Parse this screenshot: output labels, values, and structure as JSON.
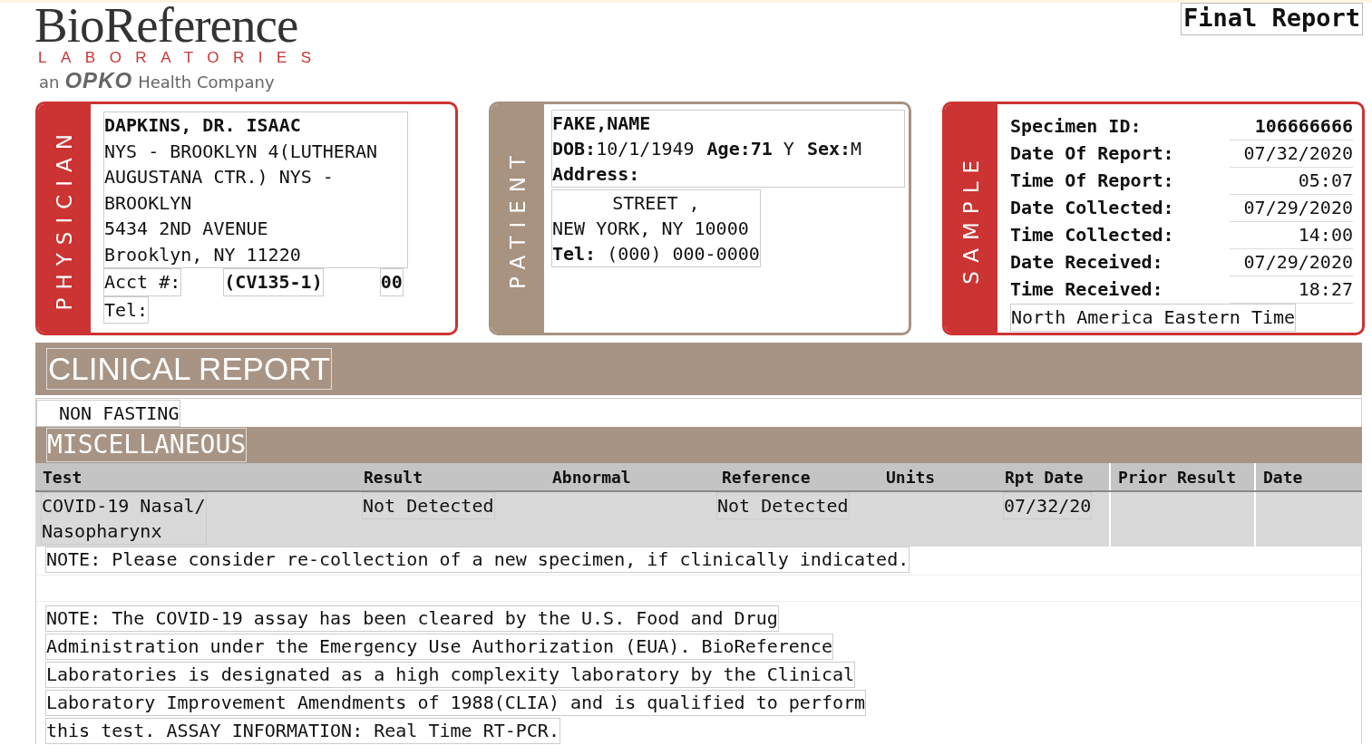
{
  "logo": {
    "name": "BioReference",
    "subtitle": "LABORATORIES",
    "prefix": "an",
    "brand": "OPKO",
    "suffix": "Health Company"
  },
  "report_status": "Final Report",
  "physician": {
    "label": "PHYSICIAN",
    "name": "DAPKINS, DR. ISAAC",
    "address_lines": [
      "NYS - BROOKLYN 4(LUTHERAN",
      "AUGUSTANA CTR.) NYS -",
      "BROOKLYN",
      "5434 2ND AVENUE",
      "Brooklyn, NY 11220"
    ],
    "acct_label": "Acct #:",
    "acct_value": "(CV135-1)",
    "acct_suffix": "00",
    "tel_label": "Tel:"
  },
  "patient": {
    "label": "PATIENT",
    "name": "FAKE,NAME",
    "dob_label": "DOB:",
    "dob": "10/1/1949",
    "age_label": "Age:",
    "age": "71",
    "age_unit": "Y",
    "sex_label": "Sex:",
    "sex": "M",
    "address_label": "Address:",
    "address_lines": [
      "STREET ,",
      "NEW YORK, NY 10000"
    ],
    "tel_label": "Tel:",
    "tel": "(000) 000-0000"
  },
  "sample": {
    "label": "SAMPLE",
    "fields": [
      {
        "label": "Specimen ID:",
        "value": "106666666"
      },
      {
        "label": "Date Of Report:",
        "value": "07/32/2020"
      },
      {
        "label": "Time Of Report:",
        "value": "05:07"
      },
      {
        "label": "Date Collected:",
        "value": "07/29/2020"
      },
      {
        "label": "Time Collected:",
        "value": "14:00"
      },
      {
        "label": "Date Received:",
        "value": "07/29/2020"
      },
      {
        "label": "Time Received:",
        "value": "18:27"
      }
    ],
    "timezone": "North America Eastern Time"
  },
  "clinical_report": {
    "title": "CLINICAL REPORT",
    "fasting": "NON FASTING",
    "section": "MISCELLANEOUS",
    "table": {
      "columns": [
        "Test",
        "Result",
        "Abnormal",
        "Reference",
        "Units",
        "Rpt Date",
        "Prior Result",
        "Date"
      ],
      "rows": [
        {
          "test": [
            "COVID-19 Nasal/",
            "Nasopharynx"
          ],
          "result": "Not Detected",
          "reference": "Not Detected",
          "rpt_date": "07/32/20"
        }
      ]
    },
    "note": "NOTE: Please consider re-collection of a new specimen, if clinically indicated.",
    "assay_note_lines": [
      "NOTE: The COVID-19 assay has been cleared by the U.S. Food and Drug",
      "Administration under the Emergency Use Authorization (EUA). BioReference",
      "Laboratories is designated as a high complexity laboratory by the Clinical",
      "Laboratory Improvement Amendments of 1988(CLIA) and is qualified to perform",
      "this test. ASSAY INFORMATION: Real Time RT-PCR."
    ]
  }
}
